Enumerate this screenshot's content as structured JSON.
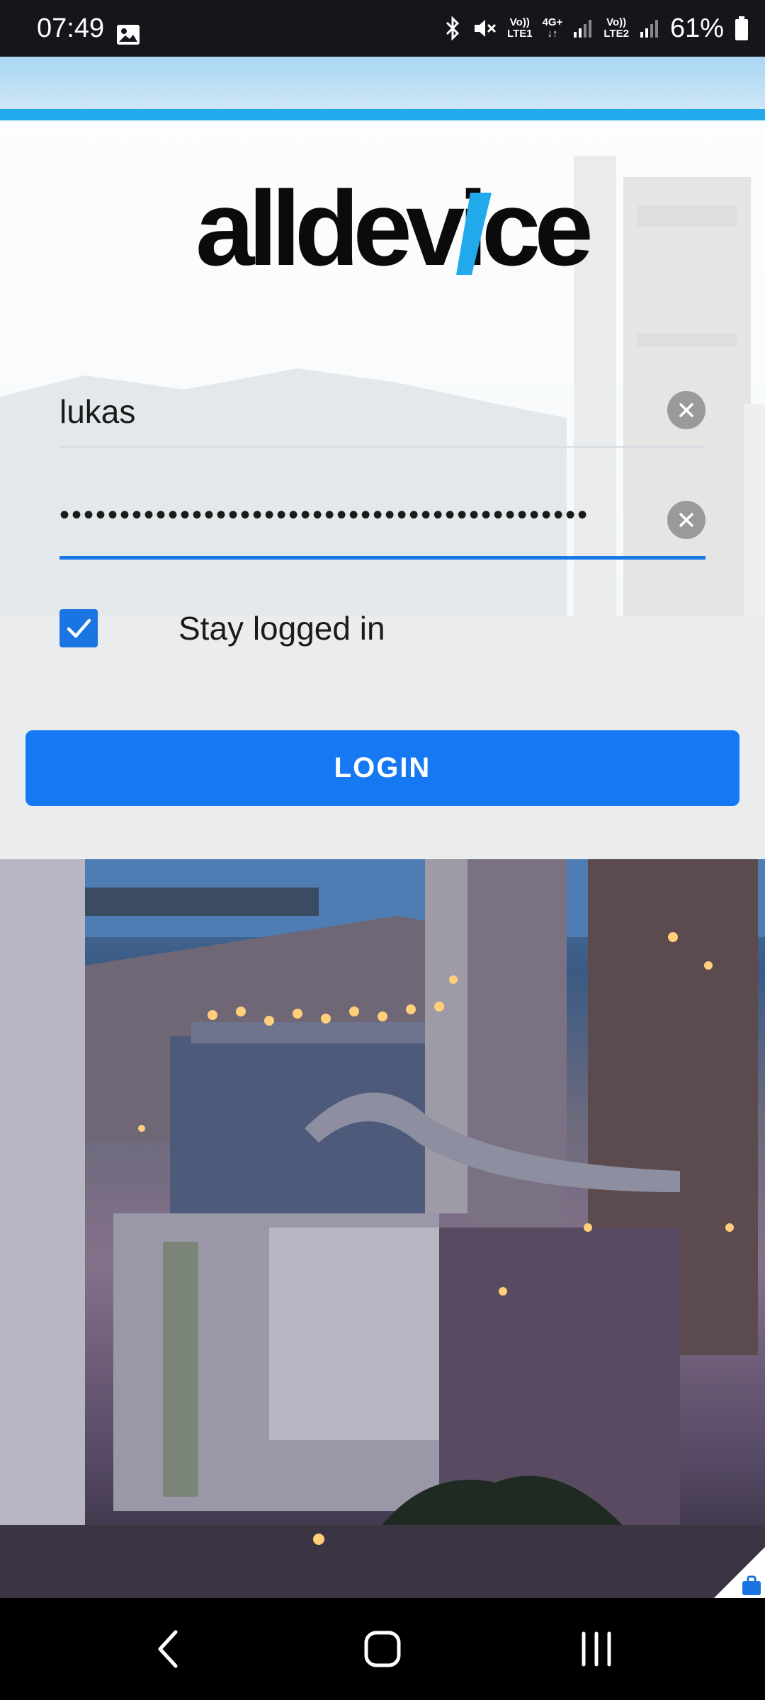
{
  "status_bar": {
    "time": "07:49",
    "battery": "61%",
    "sim1_top": "Vo))",
    "sim1_bottom": "LTE1",
    "net_top": "4G+",
    "sim2_top": "Vo))",
    "sim2_bottom": "LTE2",
    "icons": [
      "photo-icon",
      "bluetooth-icon",
      "mute-icon",
      "signal-icon",
      "battery-icon"
    ]
  },
  "brand": {
    "logo_text": "alldevice",
    "accent": "#21a9ec"
  },
  "form": {
    "username_value": "lukas",
    "password_mask": "••••••••••••••••••••••••••••••••••••••••••••",
    "stay_logged_in_label": "Stay logged in",
    "stay_logged_in_checked": true,
    "login_label": "LOGIN"
  },
  "colors": {
    "primary": "#1479f3",
    "checkbox": "#1a75e3",
    "focus_line": "#1878e6"
  },
  "nav": {
    "icons": [
      "back-icon",
      "home-icon",
      "recents-icon"
    ]
  }
}
